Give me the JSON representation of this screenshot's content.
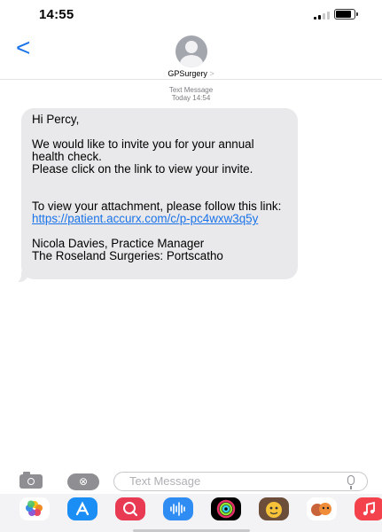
{
  "status_bar": {
    "time": "14:55"
  },
  "header": {
    "back_label": "<",
    "contact_name": "GPSurgery",
    "contact_chevron": ">"
  },
  "meta": {
    "label": "Text Message",
    "timestamp": "Today 14:54"
  },
  "message": {
    "greeting": "Hi Percy,",
    "paragraph1": "We would like to invite you for your annual health check.",
    "paragraph2": "Please click on the link to view your invite.",
    "paragraph3_prefix": "To view your attachment, please follow this link: ",
    "link_text": "https://patient.accurx.com/c/p-pc4wxw3q5y",
    "signature_line1": "Nicola Davies, Practice Manager",
    "signature_line2": "The Roseland Surgeries: Portscatho"
  },
  "input_bar": {
    "placeholder": "Text Message",
    "camera_icon": "camera-icon",
    "appstore_icon": "appstore-icon",
    "mic_icon": "mic-icon"
  },
  "app_drawer": [
    {
      "name": "photos-icon",
      "color": "#ffffff"
    },
    {
      "name": "app-store-icon",
      "color": "#1b8ef5"
    },
    {
      "name": "search-images-icon",
      "color": "#e83a53"
    },
    {
      "name": "audio-message-icon",
      "color": "#2f8cf2"
    },
    {
      "name": "activity-icon",
      "color": "#000000"
    },
    {
      "name": "memoji-icon",
      "color": "#f5c23a"
    },
    {
      "name": "animoji-icon",
      "color": "#f08d3a"
    },
    {
      "name": "music-icon",
      "color": "#f3424c"
    }
  ],
  "colors": {
    "accent": "#1a73e8",
    "bubble": "#e9e9eb"
  }
}
